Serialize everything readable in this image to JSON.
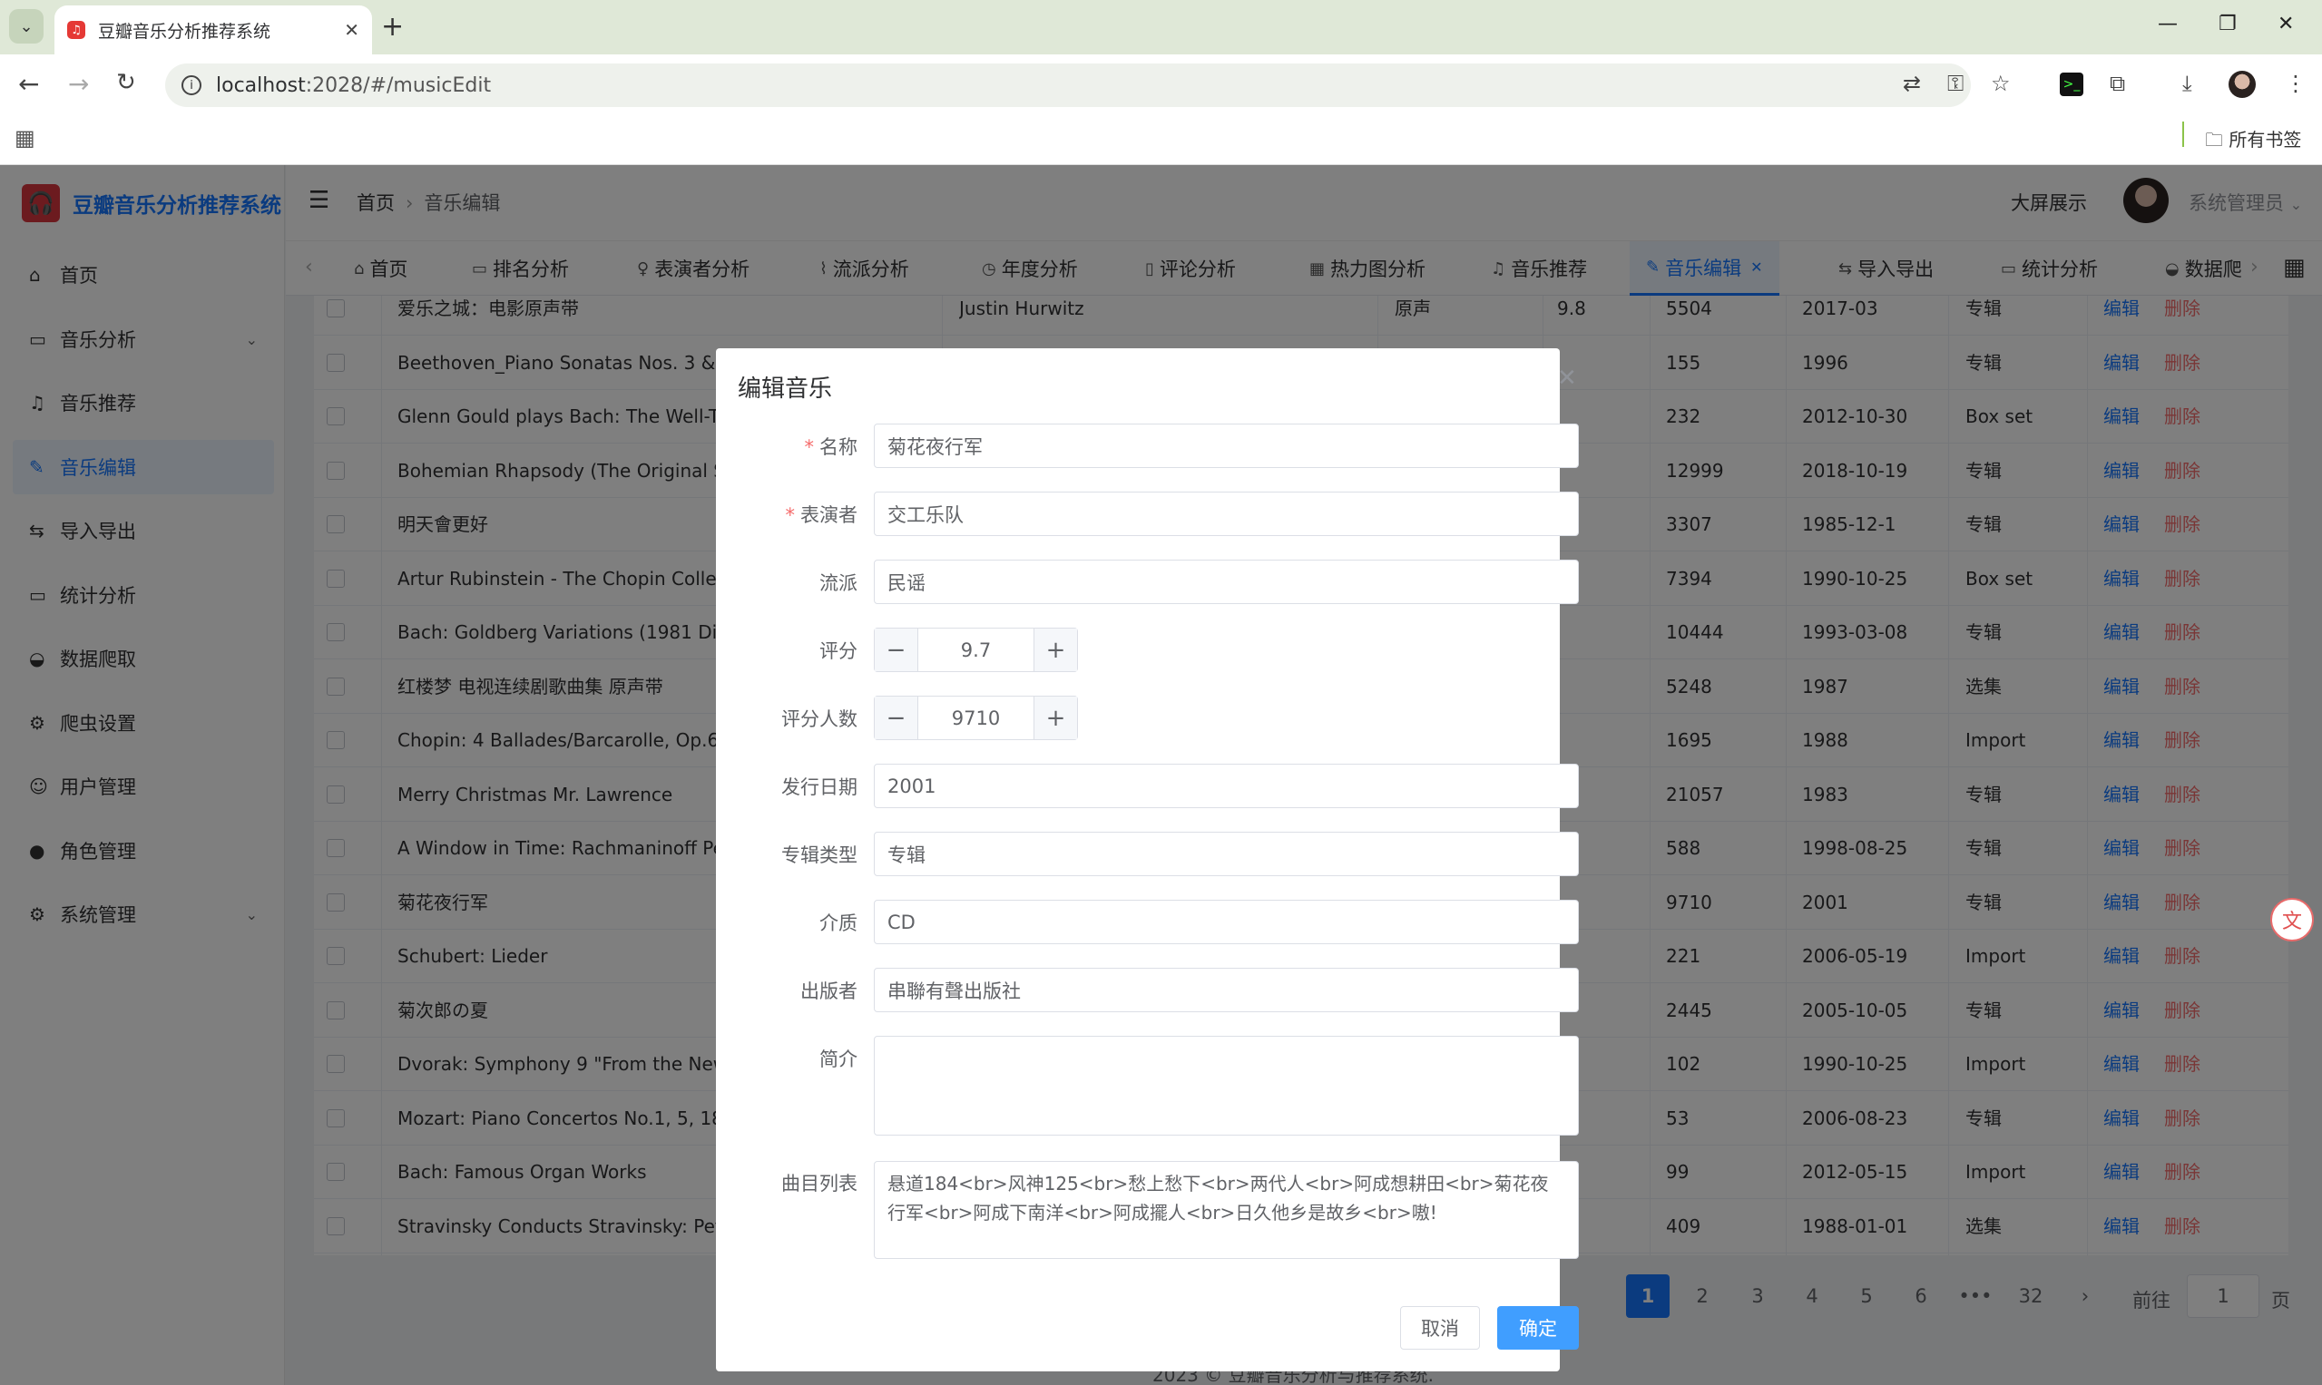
{
  "browser": {
    "tab_title": "豆瓣音乐分析推荐系统",
    "url_host": "localhost",
    "url_rest": ":2028/#/musicEdit",
    "bookmarks_label": "所有书签"
  },
  "app": {
    "brand": "豆瓣音乐分析推荐系统",
    "breadcrumb": [
      "首页",
      "音乐编辑"
    ],
    "big_screen": "大屏展示",
    "user": "系统管理员"
  },
  "sidebar": {
    "items": [
      {
        "label": "首页",
        "icon": "home-icon"
      },
      {
        "label": "音乐分析",
        "icon": "monitor-icon"
      },
      {
        "label": "音乐推荐",
        "icon": "headphones-icon"
      },
      {
        "label": "音乐编辑",
        "icon": "edit-icon"
      },
      {
        "label": "导入导出",
        "icon": "swap-icon"
      },
      {
        "label": "统计分析",
        "icon": "monitor-icon"
      },
      {
        "label": "数据爬取",
        "icon": "bowl-icon"
      },
      {
        "label": "爬虫设置",
        "icon": "gear-icon"
      },
      {
        "label": "用户管理",
        "icon": "user-icon"
      },
      {
        "label": "角色管理",
        "icon": "user-solid-icon"
      },
      {
        "label": "系统管理",
        "icon": "gear-icon"
      }
    ]
  },
  "tags": [
    {
      "label": "首页"
    },
    {
      "label": "排名分析"
    },
    {
      "label": "表演者分析"
    },
    {
      "label": "流派分析"
    },
    {
      "label": "年度分析"
    },
    {
      "label": "评论分析"
    },
    {
      "label": "热力图分析"
    },
    {
      "label": "音乐推荐"
    },
    {
      "label": "音乐编辑"
    },
    {
      "label": "导入导出"
    },
    {
      "label": "统计分析"
    },
    {
      "label": "数据爬"
    }
  ],
  "table": {
    "edit_label": "编辑",
    "delete_label": "删除",
    "rows": [
      {
        "title": "爱乐之城：电影原声带",
        "artist": "Justin Hurwitz",
        "genre": "原声",
        "score": "9.8",
        "votes": "5504",
        "date": "2017-03",
        "type": "专辑"
      },
      {
        "title": "Beethoven_Piano Sonatas Nos. 3 & 2",
        "artist": "",
        "genre": "",
        "score": "",
        "votes": "155",
        "date": "1996",
        "type": "专辑"
      },
      {
        "title": "Glenn Gould plays Bach: The Well-Te",
        "artist": "",
        "genre": "",
        "score": "",
        "votes": "232",
        "date": "2012-10-30",
        "type": "Box set"
      },
      {
        "title": "Bohemian Rhapsody (The Original Sc",
        "artist": "",
        "genre": "",
        "score": "",
        "votes": "12999",
        "date": "2018-10-19",
        "type": "专辑"
      },
      {
        "title": "明天會更好",
        "artist": "",
        "genre": "",
        "score": "",
        "votes": "3307",
        "date": "1985-12-1",
        "type": "专辑"
      },
      {
        "title": "Artur Rubinstein - The Chopin Collecti",
        "artist": "",
        "genre": "",
        "score": "",
        "votes": "7394",
        "date": "1990-10-25",
        "type": "Box set"
      },
      {
        "title": "Bach: Goldberg Variations (1981 Digit",
        "artist": "",
        "genre": "",
        "score": "",
        "votes": "10444",
        "date": "1993-03-08",
        "type": "专辑"
      },
      {
        "title": "红楼梦 电视连续剧歌曲集 原声带",
        "artist": "",
        "genre": "",
        "score": "",
        "votes": "5248",
        "date": "1987",
        "type": "选集"
      },
      {
        "title": "Chopin: 4 Ballades/Barcarolle, Op.60/",
        "artist": "",
        "genre": "",
        "score": "",
        "votes": "1695",
        "date": "1988",
        "type": "Import"
      },
      {
        "title": "Merry Christmas Mr. Lawrence",
        "artist": "",
        "genre": "",
        "score": "",
        "votes": "21057",
        "date": "1983",
        "type": "专辑"
      },
      {
        "title": "A Window in Time: Rachmaninoff Perf",
        "artist": "",
        "genre": "",
        "score": "",
        "votes": "588",
        "date": "1998-08-25",
        "type": "专辑"
      },
      {
        "title": "菊花夜行军",
        "artist": "",
        "genre": "",
        "score": "",
        "votes": "9710",
        "date": "2001",
        "type": "专辑"
      },
      {
        "title": "Schubert: Lieder",
        "artist": "",
        "genre": "",
        "score": "",
        "votes": "221",
        "date": "2006-05-19",
        "type": "Import"
      },
      {
        "title": "菊次郎の夏",
        "artist": "",
        "genre": "",
        "score": "",
        "votes": "2445",
        "date": "2005-10-05",
        "type": "专辑"
      },
      {
        "title": "Dvorak: Symphony 9 \"From the New W",
        "artist": "",
        "genre": "",
        "score": "",
        "votes": "102",
        "date": "1990-10-25",
        "type": "Import"
      },
      {
        "title": "Mozart: Piano Concertos No.1, 5, 18",
        "artist": "",
        "genre": "",
        "score": "",
        "votes": "53",
        "date": "2006-08-23",
        "type": "专辑"
      },
      {
        "title": "Bach: Famous Organ Works",
        "artist": "",
        "genre": "",
        "score": "",
        "votes": "99",
        "date": "2012-05-15",
        "type": "Import"
      },
      {
        "title": "Stravinsky Conducts Stravinsky: Petru",
        "artist": "",
        "genre": "",
        "score": "",
        "votes": "409",
        "date": "1988-01-01",
        "type": "选集"
      }
    ]
  },
  "pagination": {
    "pages": [
      "1",
      "2",
      "3",
      "4",
      "5",
      "6",
      "•••",
      "32"
    ],
    "current": "1",
    "goto_label": "前往",
    "goto_value": "1",
    "page_suffix": "页"
  },
  "footer": "2023 © 豆瓣音乐分析与推荐系统.",
  "dialog": {
    "title": "编辑音乐",
    "fields": {
      "name": {
        "label": "名称",
        "value": "菊花夜行军"
      },
      "artist": {
        "label": "表演者",
        "value": "交工乐队"
      },
      "genre": {
        "label": "流派",
        "value": "民谣"
      },
      "score": {
        "label": "评分",
        "value": "9.7"
      },
      "votes": {
        "label": "评分人数",
        "value": "9710"
      },
      "release": {
        "label": "发行日期",
        "value": "2001"
      },
      "album_type": {
        "label": "专辑类型",
        "value": "专辑"
      },
      "medium": {
        "label": "介质",
        "value": "CD"
      },
      "publisher": {
        "label": "出版者",
        "value": "串聯有聲出版社"
      },
      "intro": {
        "label": "简介",
        "value": ""
      },
      "tracks": {
        "label": "曲目列表",
        "value": "悬道184<br>风神125<br>愁上愁下<br>两代人<br>阿成想耕田<br>菊花夜行军<br>阿成下南洋<br>阿成擺人<br>日久他乡是故乡<br>嗷!"
      }
    },
    "cancel": "取消",
    "confirm": "确定"
  }
}
